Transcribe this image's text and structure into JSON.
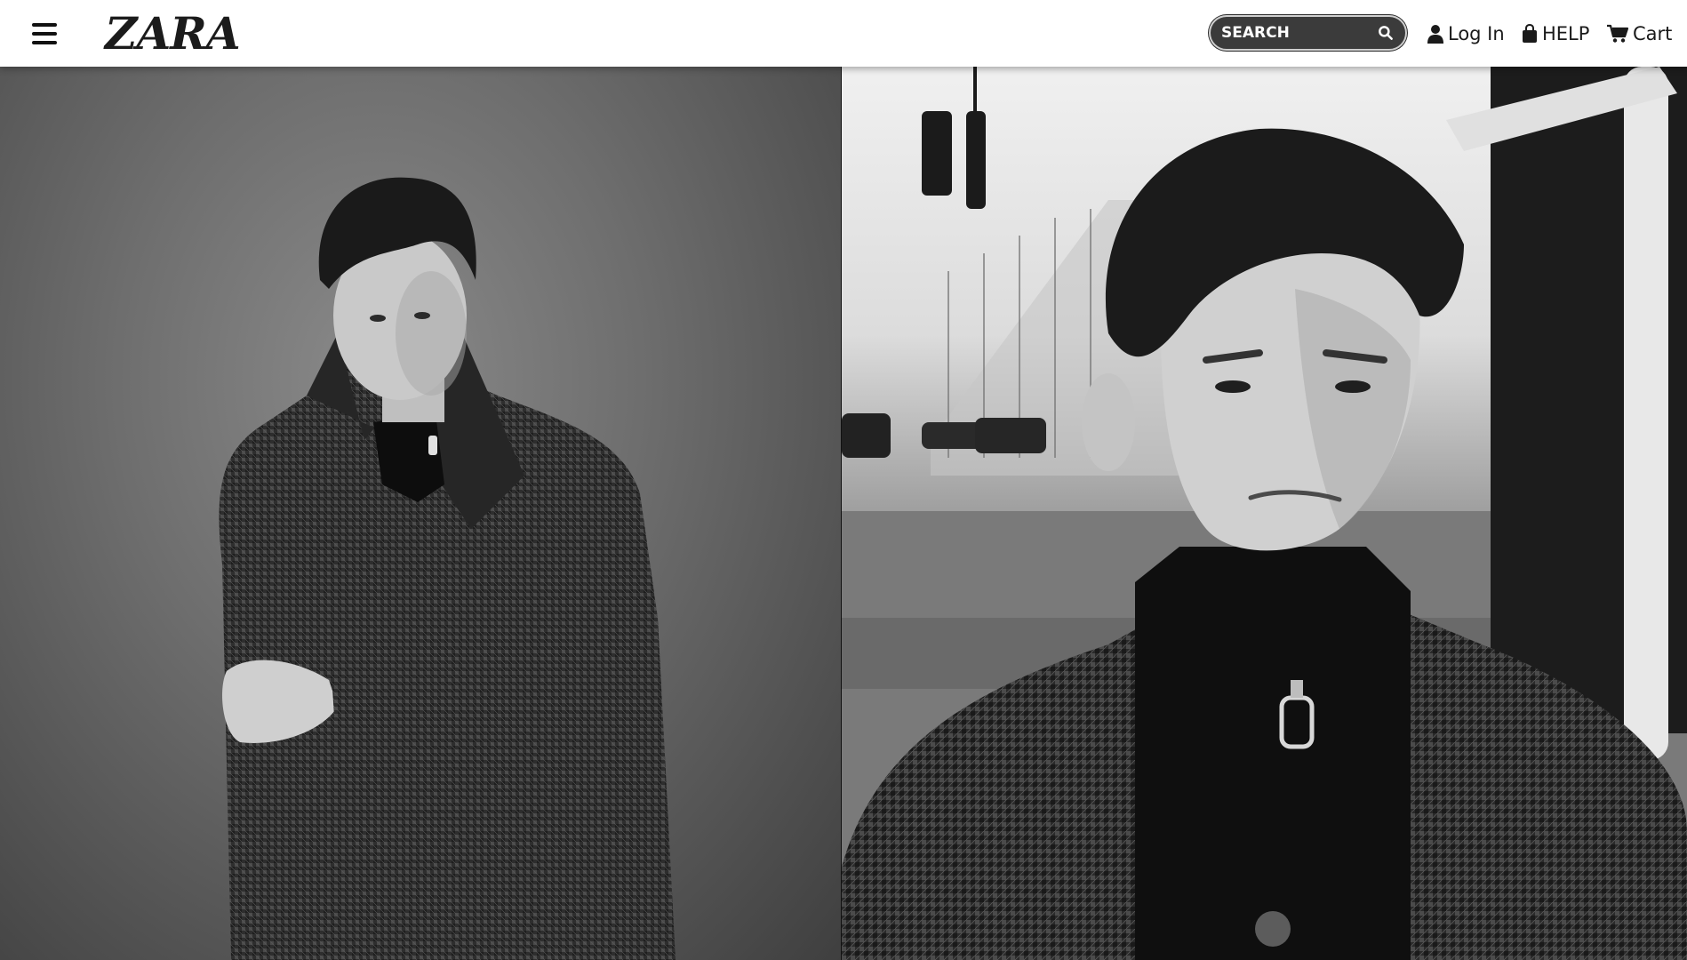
{
  "header": {
    "logo": "ZARA",
    "search": {
      "placeholder": "SEARCH"
    },
    "nav": {
      "login": "Log In",
      "help": "HELP",
      "cart": "Cart"
    }
  },
  "hero": {
    "images": [
      {
        "alt": "Man in checked wool coat seated against grey studio backdrop"
      },
      {
        "alt": "Close-up of man in checked coat on city street"
      }
    ]
  },
  "colors": {
    "header_bg": "#ffffff",
    "search_bg": "#3b3b3b",
    "text": "#1a1a1a"
  }
}
